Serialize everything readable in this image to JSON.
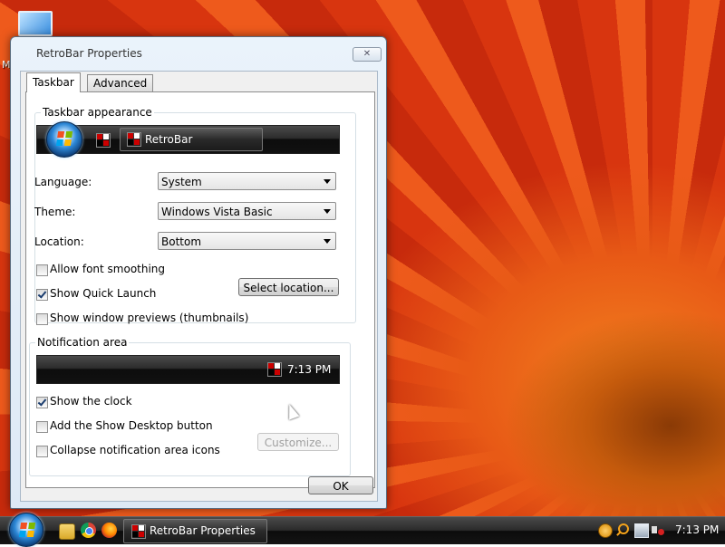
{
  "desktop": {
    "icon_label": "M"
  },
  "window": {
    "title": "RetroBar Properties",
    "close_glyph": "✕",
    "tabs": [
      {
        "label": "Taskbar"
      },
      {
        "label": "Advanced"
      }
    ],
    "appearance": {
      "group_label": "Taskbar appearance",
      "preview_task_label": "RetroBar"
    },
    "language": {
      "label": "Language:",
      "value": "System"
    },
    "theme": {
      "label": "Theme:",
      "value": "Windows Vista Basic"
    },
    "location": {
      "label": "Location:",
      "value": "Bottom"
    },
    "options": {
      "font_smoothing": {
        "label": "Allow font smoothing",
        "checked": false
      },
      "quick_launch": {
        "label": "Show Quick Launch",
        "checked": true
      },
      "previews": {
        "label": "Show window previews (thumbnails)",
        "checked": false
      }
    },
    "select_location_label": "Select location...",
    "notification": {
      "group_label": "Notification area",
      "preview_time": "7:13 PM",
      "show_clock": {
        "label": "Show the clock",
        "checked": true
      },
      "show_desktop": {
        "label": "Add the Show Desktop button",
        "checked": false
      },
      "collapse": {
        "label": "Collapse notification area icons",
        "checked": false
      },
      "customize_label": "Customize..."
    },
    "ok_label": "OK"
  },
  "taskbar": {
    "task_label": "RetroBar Properties",
    "clock": "7:13 PM",
    "quick_launch_icons": [
      "folder-icon",
      "chrome-icon",
      "firefox-icon"
    ],
    "tray_icons": [
      "clock-tray-icon",
      "search-tray-icon",
      "network-tray-icon",
      "volume-muted-icon"
    ]
  }
}
